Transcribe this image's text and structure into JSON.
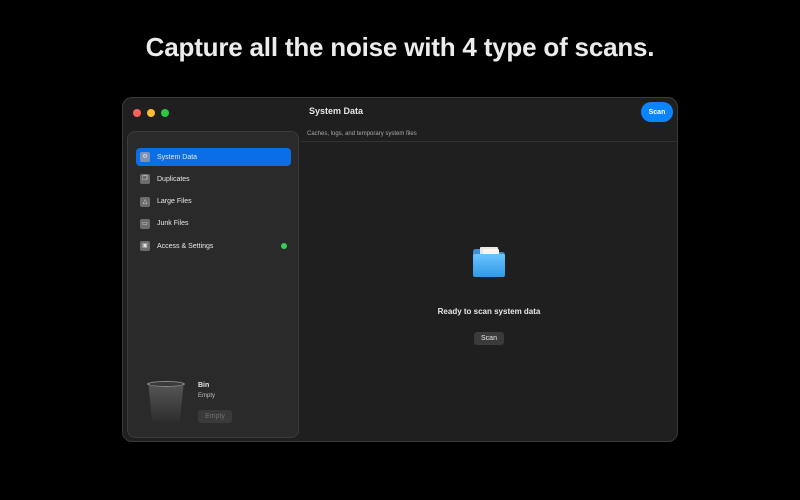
{
  "headline": "Capture all the noise with 4 type of scans.",
  "window": {
    "title": "System Data",
    "scan_label": "Scan"
  },
  "sidebar": {
    "items": [
      {
        "label": "System Data",
        "icon": "gear-icon",
        "active": true
      },
      {
        "label": "Duplicates",
        "icon": "duplicate-icon",
        "active": false
      },
      {
        "label": "Large Files",
        "icon": "weight-icon",
        "active": false
      },
      {
        "label": "Junk Files",
        "icon": "trash-icon",
        "active": false
      },
      {
        "label": "Access & Settings",
        "icon": "lock-icon",
        "active": false,
        "status_color": "#30d158"
      }
    ],
    "bin": {
      "name": "Bin",
      "status": "Empty",
      "empty_label": "Empty"
    }
  },
  "main": {
    "subtitle": "Caches, logs, and temporary system files",
    "ready_text": "Ready to scan system data",
    "scan_label": "Scan"
  },
  "colors": {
    "accent": "#0a84ff",
    "active_item": "#0a6fe6",
    "status_green": "#30d158"
  }
}
